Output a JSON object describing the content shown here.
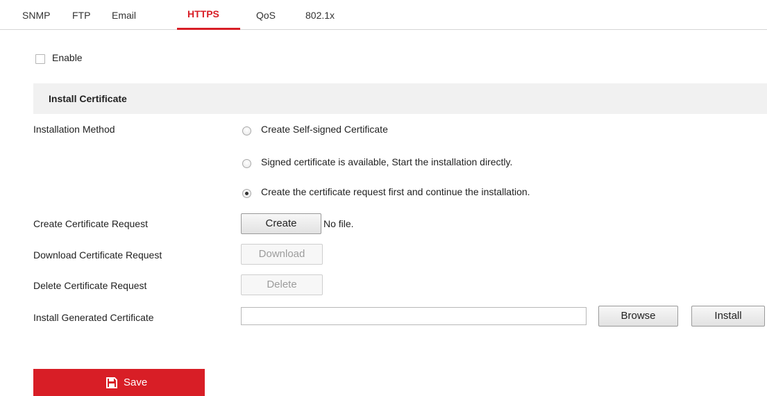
{
  "tabs": [
    {
      "label": "SNMP",
      "active": false
    },
    {
      "label": "FTP",
      "active": false
    },
    {
      "label": "Email",
      "active": false
    },
    {
      "label": "HTTPS",
      "active": true
    },
    {
      "label": "QoS",
      "active": false
    },
    {
      "label": "802.1x",
      "active": false
    }
  ],
  "enable": {
    "label": "Enable",
    "checked": false
  },
  "section": {
    "title": "Install Certificate"
  },
  "installation_method": {
    "label": "Installation Method",
    "options": [
      {
        "label": "Create Self-signed Certificate",
        "selected": false
      },
      {
        "label": "Signed certificate is available, Start the installation directly.",
        "selected": false
      },
      {
        "label": "Create the certificate request first and continue the installation.",
        "selected": true
      }
    ]
  },
  "create_request": {
    "label": "Create Certificate Request",
    "button": "Create",
    "status": "No file."
  },
  "download_request": {
    "label": "Download Certificate Request",
    "button": "Download",
    "enabled": false
  },
  "delete_request": {
    "label": "Delete Certificate Request",
    "button": "Delete",
    "enabled": false
  },
  "install_generated": {
    "label": "Install Generated Certificate",
    "file_value": "",
    "browse_button": "Browse",
    "install_button": "Install"
  },
  "save": {
    "label": "Save",
    "icon": "save-icon"
  },
  "colors": {
    "accent": "#d81e26",
    "section_bg": "#f1f1f1",
    "text": "#222222",
    "disabled_text": "#9c9c9c"
  }
}
